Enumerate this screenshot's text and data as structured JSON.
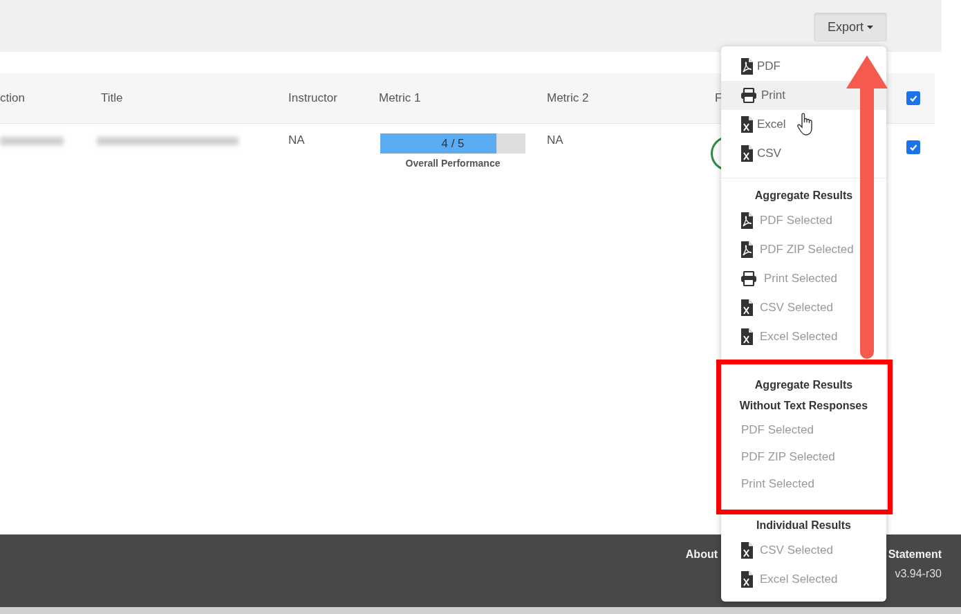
{
  "toolbar": {
    "export_button": {
      "label": "Export",
      "expanded": true
    }
  },
  "table": {
    "columns": [
      {
        "label": "ction"
      },
      {
        "label": "Title"
      },
      {
        "label": "Instructor"
      },
      {
        "label": "Metric 1"
      },
      {
        "label": "Metric 2"
      },
      {
        "label": "F"
      }
    ],
    "header_checkbox": {
      "checked": true
    },
    "rows": [
      {
        "instructor": "NA",
        "metric_1": {
          "reading": "4 / 5",
          "level": 0.8,
          "caption": "Overall Performance"
        },
        "metric_2": "NA",
        "checked": true
      }
    ]
  },
  "export_menu": {
    "sections": [
      {
        "items": [
          {
            "label": "PDF",
            "kind": "pdf",
            "highlighted": false,
            "dimmed": false
          },
          {
            "label": "Print",
            "kind": "print",
            "highlighted": true,
            "dimmed": false
          },
          {
            "label": "Excel",
            "kind": "sheet",
            "highlighted": false,
            "dimmed": false
          },
          {
            "label": "CSV",
            "kind": "sheet",
            "highlighted": false,
            "dimmed": false
          }
        ]
      },
      {
        "heading": [
          "Aggregate Results"
        ],
        "items": [
          {
            "label": "PDF Selected",
            "kind": "pdf",
            "highlighted": false,
            "dimmed": true
          },
          {
            "label": "PDF ZIP Selected",
            "kind": "pdf",
            "highlighted": false,
            "dimmed": true
          },
          {
            "label": "Print Selected",
            "kind": "print",
            "highlighted": false,
            "dimmed": true
          },
          {
            "label": "CSV Selected",
            "kind": "sheet",
            "highlighted": false,
            "dimmed": true
          },
          {
            "label": "Excel Selected",
            "kind": "sheet",
            "highlighted": false,
            "dimmed": true
          }
        ]
      },
      {
        "heading": [
          "Aggregate Results",
          "Without Text Responses"
        ],
        "items": [
          {
            "label": "PDF Selected",
            "kind": "plain",
            "highlighted": false,
            "dimmed": true
          },
          {
            "label": "PDF ZIP Selected",
            "kind": "plain",
            "highlighted": false,
            "dimmed": true
          },
          {
            "label": "Print Selected",
            "kind": "plain",
            "highlighted": false,
            "dimmed": true
          }
        ]
      },
      {
        "heading": [
          "Individual Results"
        ],
        "items": [
          {
            "label": "CSV Selected",
            "kind": "sheet",
            "highlighted": false,
            "dimmed": true
          },
          {
            "label": "Excel Selected",
            "kind": "sheet",
            "highlighted": false,
            "dimmed": true
          }
        ]
      }
    ]
  },
  "footer": {
    "links": [
      "About",
      "Statement"
    ],
    "version": "v3.94-r30"
  }
}
